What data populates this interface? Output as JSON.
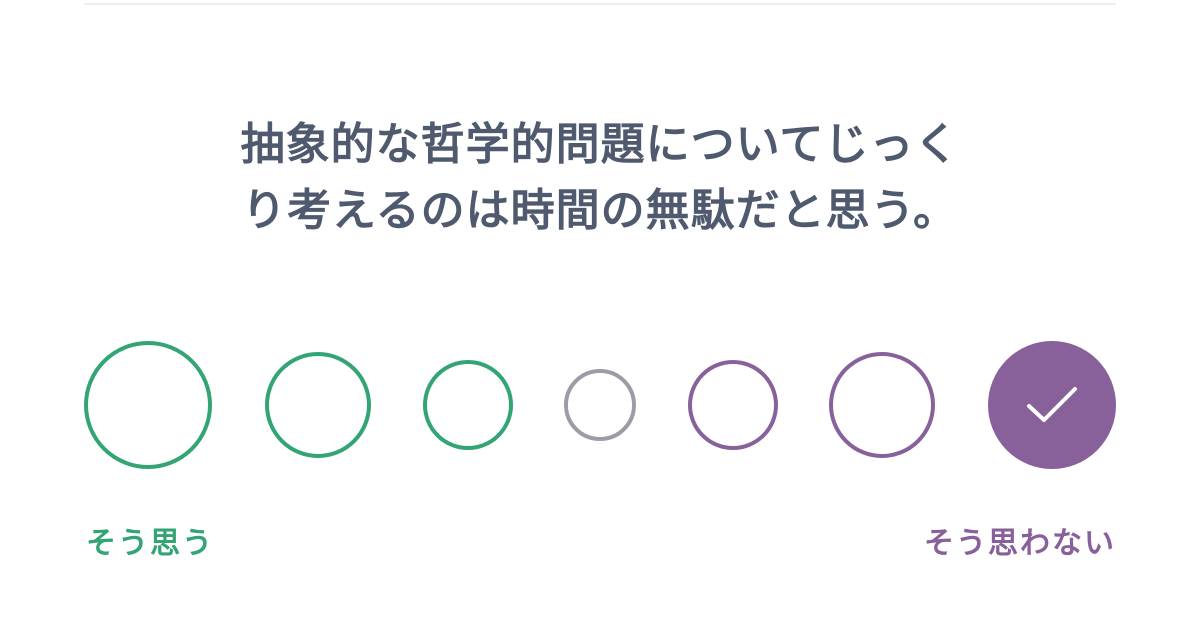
{
  "question": {
    "line1": "抽象的な哲学的問題についてじっく",
    "line2": "り考えるのは時間の無駄だと思う。"
  },
  "scale": {
    "options": [
      {
        "tone": "agree",
        "selected": false
      },
      {
        "tone": "agree",
        "selected": false
      },
      {
        "tone": "agree",
        "selected": false
      },
      {
        "tone": "neutral",
        "selected": false
      },
      {
        "tone": "disagree",
        "selected": false
      },
      {
        "tone": "disagree",
        "selected": false
      },
      {
        "tone": "disagree",
        "selected": true
      }
    ],
    "agree_label": "そう思う",
    "disagree_label": "そう思わない",
    "selected_icon": "check-icon"
  },
  "colors": {
    "agree": "#33a474",
    "neutral": "#9a9da6",
    "disagree": "#88619a",
    "question_text": "#4f5a6e",
    "divider": "#eeeef0"
  }
}
